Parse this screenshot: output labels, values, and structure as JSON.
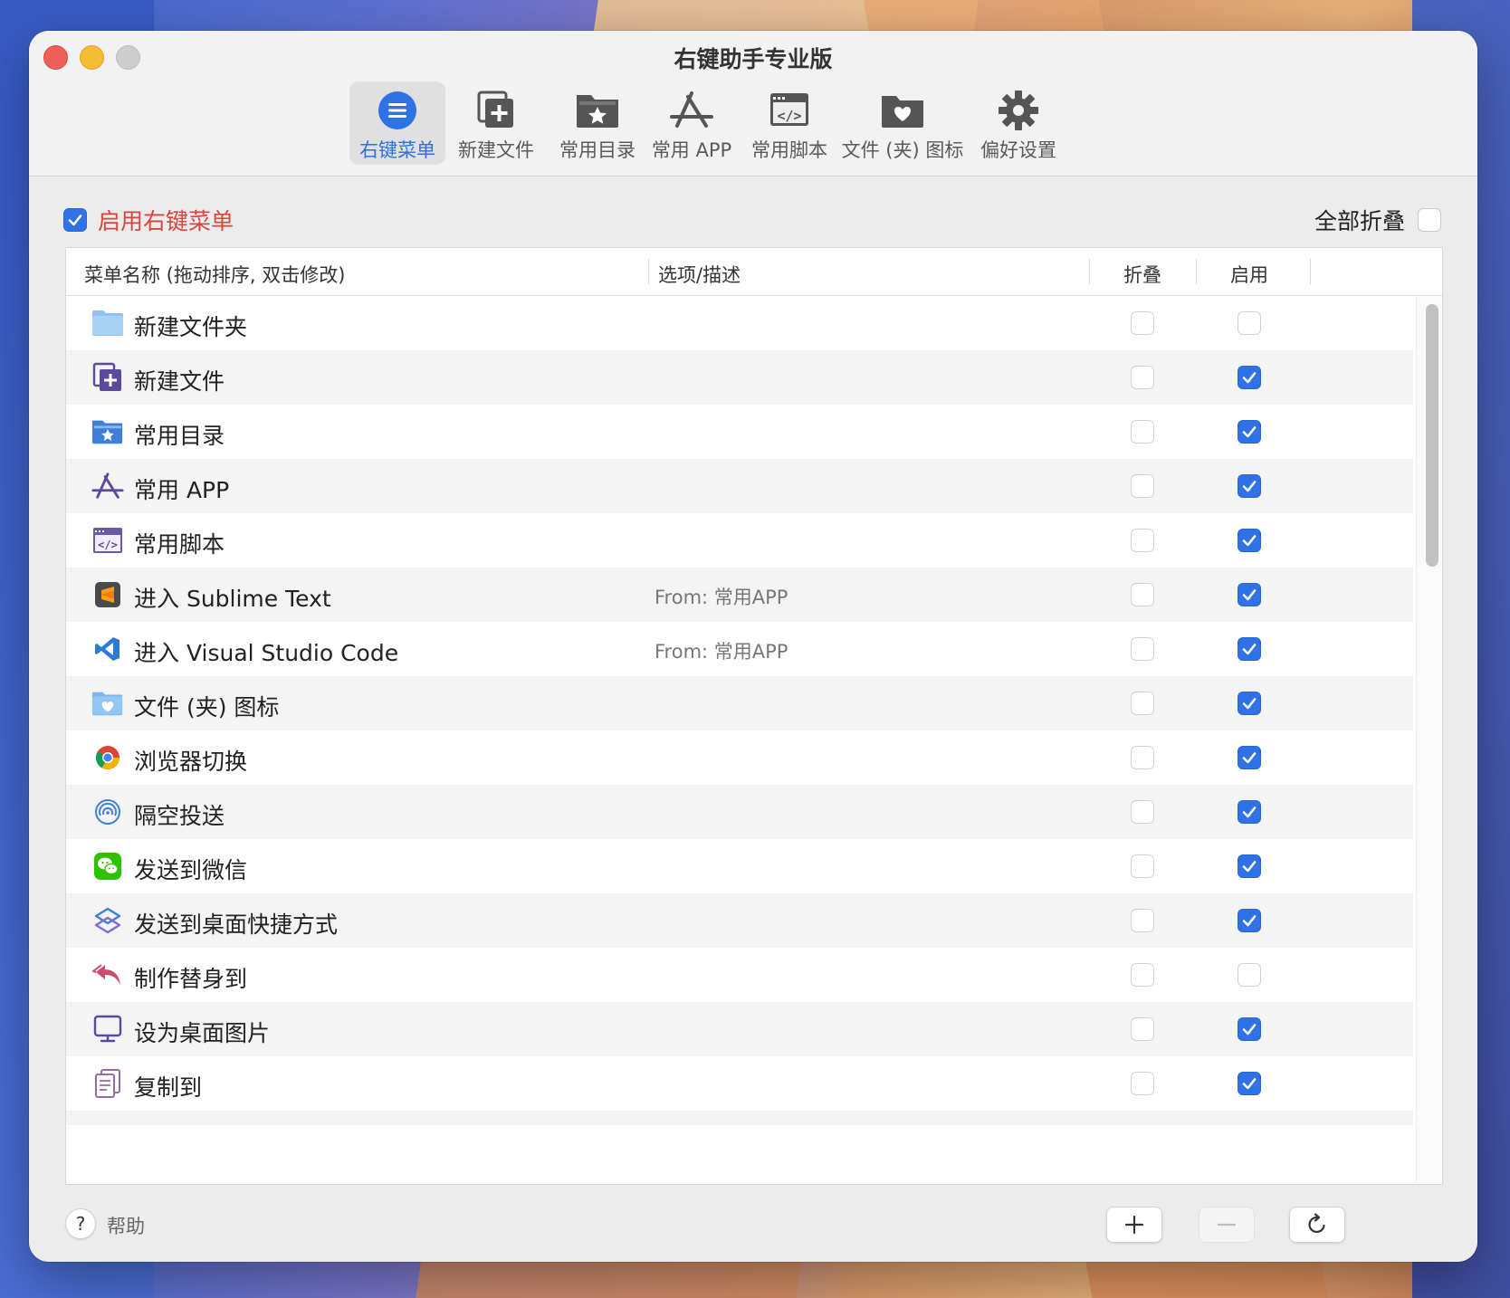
{
  "window": {
    "title": "右键助手专业版"
  },
  "toolbar": {
    "tabs": [
      {
        "label": "右键菜单",
        "icon": "menu-list-icon"
      },
      {
        "label": "新建文件",
        "icon": "new-file-icon"
      },
      {
        "label": "常用目录",
        "icon": "favorite-folder-icon"
      },
      {
        "label": "常用 APP",
        "icon": "app-store-icon"
      },
      {
        "label": "常用脚本",
        "icon": "script-icon"
      },
      {
        "label": "文件 (夹) 图标",
        "icon": "folder-heart-icon"
      },
      {
        "label": "偏好设置",
        "icon": "gear-icon"
      }
    ]
  },
  "settings": {
    "enable_label": "启用右键菜单",
    "enable_checked": true,
    "collapse_all_label": "全部折叠",
    "collapse_all_checked": false
  },
  "table": {
    "headers": {
      "name": "菜单名称 (拖动排序, 双击修改)",
      "desc": "选项/描述",
      "fold": "折叠",
      "enable": "启用"
    },
    "rows": [
      {
        "name": "新建文件夹",
        "desc": "",
        "icon": "folder-icon",
        "fold": false,
        "enabled": false
      },
      {
        "name": "新建文件",
        "desc": "",
        "icon": "new-file-icon",
        "fold": false,
        "enabled": true
      },
      {
        "name": "常用目录",
        "desc": "",
        "icon": "favorite-folder-icon",
        "fold": false,
        "enabled": true
      },
      {
        "name": "常用 APP",
        "desc": "",
        "icon": "app-store-icon",
        "fold": false,
        "enabled": true
      },
      {
        "name": "常用脚本",
        "desc": "",
        "icon": "script-icon",
        "fold": false,
        "enabled": true
      },
      {
        "name": "进入 Sublime Text",
        "desc": "From: 常用APP",
        "icon": "sublime-text-icon",
        "fold": false,
        "enabled": true
      },
      {
        "name": "进入 Visual Studio Code",
        "desc": "From: 常用APP",
        "icon": "vscode-icon",
        "fold": false,
        "enabled": true
      },
      {
        "name": "文件 (夹) 图标",
        "desc": "",
        "icon": "folder-heart-icon",
        "fold": false,
        "enabled": true
      },
      {
        "name": "浏览器切换",
        "desc": "",
        "icon": "chrome-icon",
        "fold": false,
        "enabled": true
      },
      {
        "name": "隔空投送",
        "desc": "",
        "icon": "airdrop-icon",
        "fold": false,
        "enabled": true
      },
      {
        "name": "发送到微信",
        "desc": "",
        "icon": "wechat-icon",
        "fold": false,
        "enabled": true
      },
      {
        "name": "发送到桌面快捷方式",
        "desc": "",
        "icon": "shortcuts-icon",
        "fold": false,
        "enabled": true
      },
      {
        "name": "制作替身到",
        "desc": "",
        "icon": "alias-arrow-icon",
        "fold": false,
        "enabled": false
      },
      {
        "name": "设为桌面图片",
        "desc": "",
        "icon": "desktop-picture-icon",
        "fold": false,
        "enabled": true
      },
      {
        "name": "复制到",
        "desc": "",
        "icon": "copy-to-icon",
        "fold": false,
        "enabled": true
      }
    ]
  },
  "footer": {
    "help_label": "帮助",
    "help_symbol": "?"
  },
  "colors": {
    "accent": "#2f72e6",
    "enable_label": "#d9453f",
    "icon_purple": "#5b4a9b"
  }
}
